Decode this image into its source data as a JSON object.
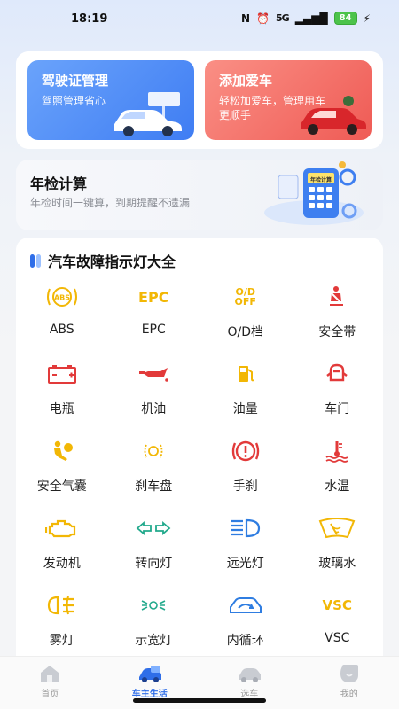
{
  "status": {
    "time": "18:19",
    "network": "5G",
    "battery": "84"
  },
  "promos": [
    {
      "title": "驾驶证管理",
      "subtitle": "驾照管理省心"
    },
    {
      "title": "添加爱车",
      "subtitle": "轻松加爱车，管理用车更顺手"
    }
  ],
  "annual_check": {
    "title": "年检计算",
    "subtitle": "年检时间一键算，到期提醒不遗漏",
    "badge": "年检计算"
  },
  "lights_section": {
    "title": "汽车故障指示灯大全",
    "items": [
      {
        "label": "ABS",
        "icon": "abs-icon",
        "glyph": "ABS"
      },
      {
        "label": "EPC",
        "icon": "epc-icon",
        "glyph": "EPC"
      },
      {
        "label": "O/D档",
        "icon": "od-off-icon",
        "glyph_top": "O/D",
        "glyph_bottom": "OFF"
      },
      {
        "label": "安全带",
        "icon": "seatbelt-icon"
      },
      {
        "label": "电瓶",
        "icon": "battery-icon"
      },
      {
        "label": "机油",
        "icon": "oil-can-icon"
      },
      {
        "label": "油量",
        "icon": "fuel-pump-icon"
      },
      {
        "label": "车门",
        "icon": "car-door-icon"
      },
      {
        "label": "安全气囊",
        "icon": "airbag-icon"
      },
      {
        "label": "刹车盘",
        "icon": "brake-disc-icon"
      },
      {
        "label": "手刹",
        "icon": "handbrake-icon"
      },
      {
        "label": "水温",
        "icon": "coolant-temp-icon"
      },
      {
        "label": "发动机",
        "icon": "engine-icon"
      },
      {
        "label": "转向灯",
        "icon": "turn-signal-icon"
      },
      {
        "label": "远光灯",
        "icon": "high-beam-icon"
      },
      {
        "label": "玻璃水",
        "icon": "washer-fluid-icon"
      },
      {
        "label": "雾灯",
        "icon": "fog-light-icon"
      },
      {
        "label": "示宽灯",
        "icon": "width-light-icon"
      },
      {
        "label": "内循环",
        "icon": "recirculation-icon"
      },
      {
        "label": "VSC",
        "icon": "vsc-icon",
        "glyph": "VSC"
      }
    ]
  },
  "nav": [
    {
      "label": "首页",
      "icon": "home-icon"
    },
    {
      "label": "车主生活",
      "icon": "car-life-icon",
      "active": true
    },
    {
      "label": "选车",
      "icon": "choose-car-icon"
    },
    {
      "label": "我的",
      "icon": "profile-icon"
    }
  ],
  "colors": {
    "accent": "#2f6ee8",
    "warning_yellow": "#f2b705",
    "danger_red": "#e23a3a",
    "teal": "#22a98c",
    "blue_icon": "#2f7de1"
  }
}
